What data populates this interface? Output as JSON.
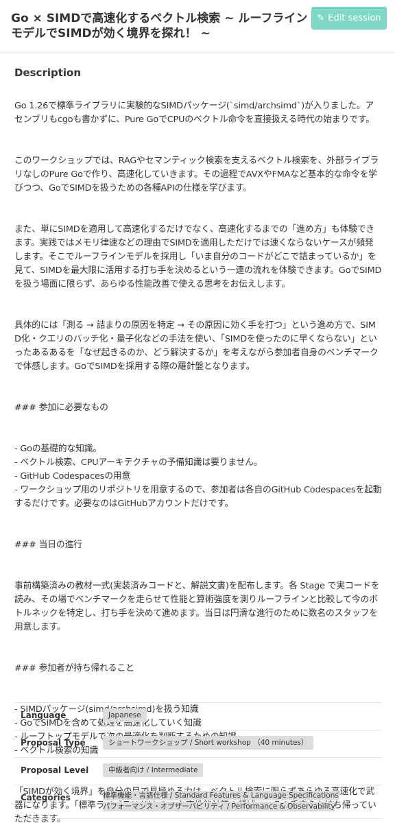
{
  "header": {
    "title": "Go × SIMDで高速化するベクトル検索 ~ ルーフラインモデルでSIMDが効く境界を探れ！ ~",
    "edit_button_label": "Edit session",
    "edit_button_icon": "pencil-icon"
  },
  "description": {
    "heading": "Description",
    "paragraphs": [
      "Go 1.26で標準ライブラリに実験的なSIMDパッケージ(`simd/archsimd`)が入りました。アセンブリもcgoも書かずに、Pure GoでCPUのベクトル命令を直接扱える時代の始まりです。",
      "このワークショップでは、RAGやセマンティック検索を支えるベクトル検索を、外部ライブラリなしのPure Goで作り、高速化していきます。その過程でAVXやFMAなど基本的な命令を学びつつ、GoでSIMDを扱うための各種APIの仕様を学びます。",
      "また、単にSIMDを適用して高速化するだけでなく、高速化するまでの「進め方」も体験できます。実践ではメモリ律速などの理由でSIMDを適用しただけでは速くならないケースが頻発します。そこでルーフラインモデルを採用し「いま自分のコードがどこで詰まっているか」を見て、SIMDを最大限に活用する打ち手を決めるという一連の流れを体験できます。GoでSIMDを扱う場面に限らず、あらゆる性能改善で使える思考をお伝えします。",
      "具体的には「測る → 詰まりの原因を特定 → その原因に効く手を打つ」という進め方で、SIMD化・クエリのバッチ化・量子化などの手法を使い、「SIMDを使ったのに早くならない」といったあるあるを「なぜ起きるのか、どう解決するか」を考えながら参加者自身のベンチマークで体感します。GoでSIMDを採用する際の羅針盤となります。",
      "### 参加に必要なもの",
      "- Goの基礎的な知識。\n- ベクトル検索、CPUアーキテクチャの予備知識は要りません。\n- GitHub Codespacesの用意\n- ワークショップ用のリポジトリを用意するので、参加者は各自のGitHub Codespacesを起動するだけです。必要なのはGitHubアカウントだけです。",
      "### 当日の進行",
      "事前構築済みの教材一式(実装済みコードと、解説文書)を配布します。各 Stage で実コードを読み、その場でベンチマークを走らせて性能と算術強度を測りルーフラインと比較して今のボトルネックを特定し、打ち手を決めて進めます。当日は円滑な進行のために数名のスタッフを用意します。",
      "### 参加者が持ち帰れること",
      "- SIMDパッケージ(simd/archsimd)を扱う知識\n- GoでSIMDを含めて処理を高速化していく知識\n- ルーフトップモデルで次の最適化を判断するための知識\n- ベクトル検索の知識",
      "「SIMDが効く境界」を自分の目で見極める力は、ベクトル検索に限らずあらゆる高速化で武器になります。「標準ライブラリだけでGoを高性能計算の領域へ」その手応えを持ち帰っていただきます。"
    ]
  },
  "meta": {
    "language_label": "Language",
    "language_value": "Japanese",
    "proposal_type_label": "Proposal Type",
    "proposal_type_value": "ショートワークショップ / Short workshop （40 minutes）",
    "proposal_level_label": "Proposal Level",
    "proposal_level_value": "中級者向け / Intermediate",
    "categories_label": "Categories",
    "categories": [
      "標準機能・言語仕様 / Standard Features & Language Specifications",
      "パフォーマンス・オブザーバビリティ / Performance & Observability"
    ]
  },
  "colors": {
    "edit_button": "#7ed8c5",
    "tag_background": "#dcdcdc",
    "text": "#333333"
  }
}
